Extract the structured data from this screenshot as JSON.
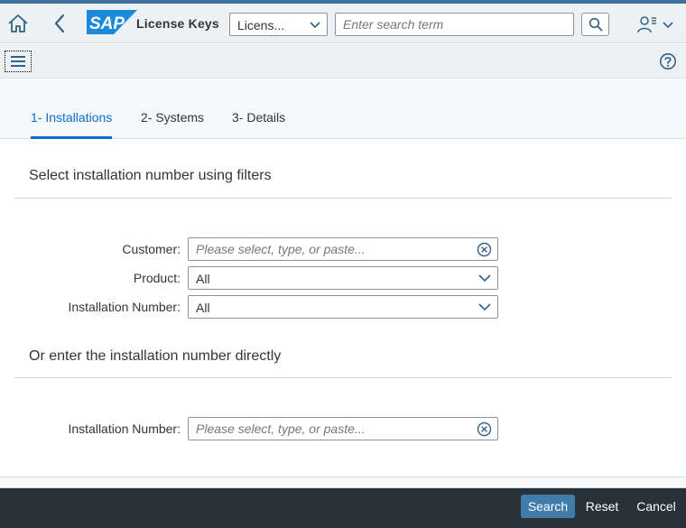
{
  "shell": {
    "app_title": "License Keys",
    "logo_text": "SAP",
    "scope_value": "Licens...",
    "search_placeholder": "Enter search term"
  },
  "tabs": [
    {
      "label": "1- Installations",
      "active": true
    },
    {
      "label": "2- Systems",
      "active": false
    },
    {
      "label": "3- Details",
      "active": false
    }
  ],
  "filters_section": {
    "title": "Select installation number using filters",
    "customer": {
      "label": "Customer:",
      "placeholder": "Please select, type, or paste..."
    },
    "product": {
      "label": "Product:",
      "value": "All"
    },
    "installation_number": {
      "label": "Installation Number:",
      "value": "All"
    }
  },
  "direct_section": {
    "title": "Or enter the installation number directly",
    "installation_number": {
      "label": "Installation Number:",
      "placeholder": "Please select, type, or paste..."
    }
  },
  "footer": {
    "search_label": "Search",
    "reset_label": "Reset",
    "cancel_label": "Cancel"
  },
  "icons": {
    "home": "home-icon",
    "back": "back-icon",
    "search": "search-icon",
    "user": "user-icon",
    "menu": "menu-icon",
    "help": "help-icon",
    "clear": "clear-icon",
    "dropdown": "chevron-down-icon"
  },
  "colors": {
    "accent": "#0a6ed1",
    "shell_bg": "#edf1f4",
    "footer_bg": "#29313a",
    "primary_button": "#427cac",
    "logo_blue": "#1b8ad9"
  }
}
